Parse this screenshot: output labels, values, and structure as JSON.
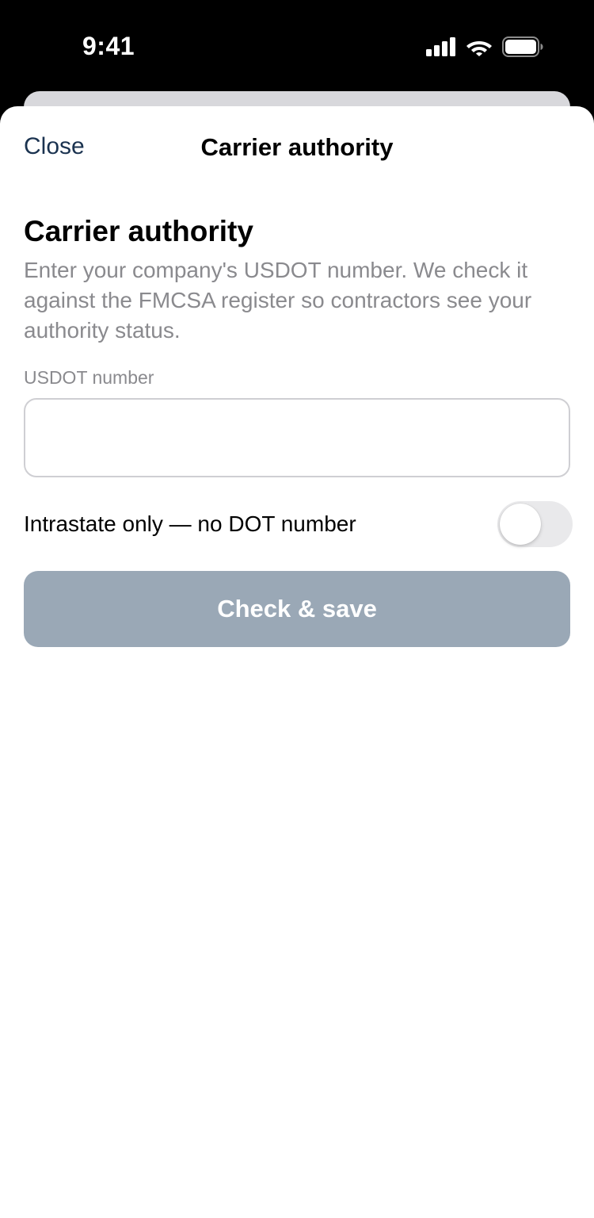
{
  "status_bar": {
    "time": "9:41",
    "icons": [
      "cellular-signal-icon",
      "wifi-icon",
      "battery-icon"
    ]
  },
  "nav": {
    "close_label": "Close",
    "title": "Carrier authority"
  },
  "form": {
    "heading": "Carrier authority",
    "description": "Enter your company's USDOT number. We check it against the FMCSA register so contractors see your authority status.",
    "usdot_label": "USDOT number",
    "usdot_value": "",
    "usdot_placeholder": "",
    "intrastate_label": "Intrastate only — no DOT number",
    "intrastate_on": false,
    "submit_label": "Check & save"
  },
  "colors": {
    "link": "#1b3350",
    "button_disabled": "#9aa8b6",
    "secondary_text": "#8a8a8e",
    "toggle_off": "#e9e9eb"
  }
}
